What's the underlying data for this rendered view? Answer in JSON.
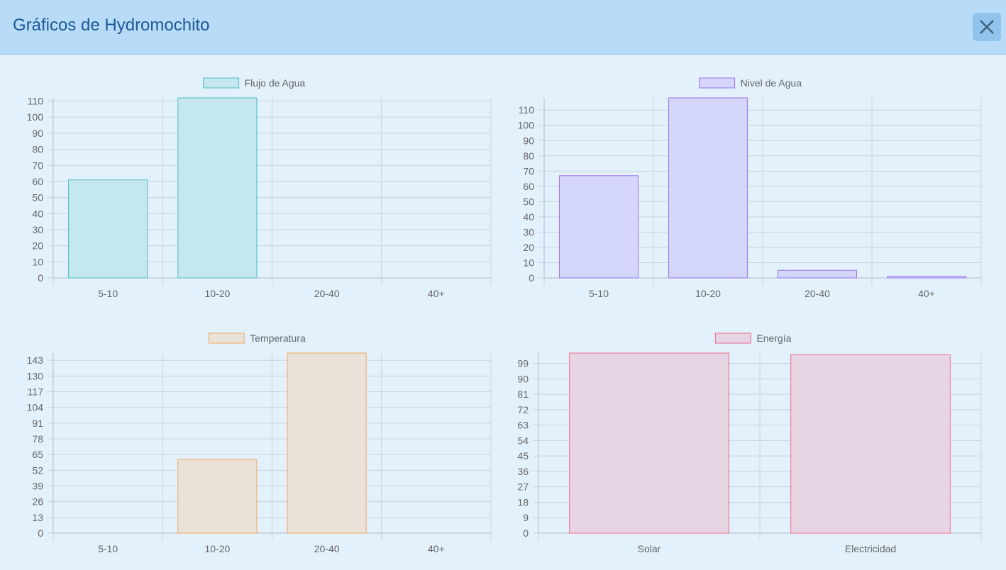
{
  "modal": {
    "title": "Gráficos de Hydromochito"
  },
  "chart_data": [
    {
      "type": "bar",
      "categories": [
        "5-10",
        "10-20",
        "20-40",
        "40+"
      ],
      "series": [
        {
          "name": "Flujo de Agua",
          "values": [
            61,
            112,
            0,
            0
          ]
        }
      ],
      "yticks": [
        0,
        10,
        20,
        30,
        40,
        50,
        60,
        70,
        80,
        90,
        100,
        110
      ],
      "ylim": [
        0,
        112
      ],
      "grid": true,
      "legend": "top",
      "colors": {
        "fill": "#c5e7ee",
        "stroke": "#4bbfc0"
      }
    },
    {
      "type": "bar",
      "categories": [
        "5-10",
        "10-20",
        "20-40",
        "40+"
      ],
      "series": [
        {
          "name": "Nivel de Agua",
          "values": [
            67,
            118,
            5,
            1
          ]
        }
      ],
      "yticks": [
        0,
        10,
        20,
        30,
        40,
        50,
        60,
        70,
        80,
        90,
        100,
        110
      ],
      "ylim": [
        0,
        118
      ],
      "grid": true,
      "legend": "top",
      "colors": {
        "fill": "#d5d6fb",
        "stroke": "#9a70ea"
      }
    },
    {
      "type": "bar",
      "categories": [
        "5-10",
        "10-20",
        "20-40",
        "40+"
      ],
      "series": [
        {
          "name": "Temperatura",
          "values": [
            0,
            61,
            149,
            0
          ]
        }
      ],
      "yticks": [
        0,
        13,
        26,
        39,
        52,
        65,
        78,
        91,
        104,
        117,
        130,
        143
      ],
      "ylim": [
        0,
        149
      ],
      "grid": true,
      "legend": "top",
      "colors": {
        "fill": "#eae2d9",
        "stroke": "#f6a85c"
      }
    },
    {
      "type": "bar",
      "categories": [
        "Solar",
        "Electricidad"
      ],
      "series": [
        {
          "name": "Energía",
          "values": [
            105,
            104
          ]
        }
      ],
      "yticks": [
        0,
        9,
        18,
        27,
        36,
        45,
        54,
        63,
        72,
        81,
        90,
        99
      ],
      "ylim": [
        0,
        105
      ],
      "grid": true,
      "legend": "top",
      "colors": {
        "fill": "#e8d5e4",
        "stroke": "#ee6a86"
      }
    }
  ]
}
